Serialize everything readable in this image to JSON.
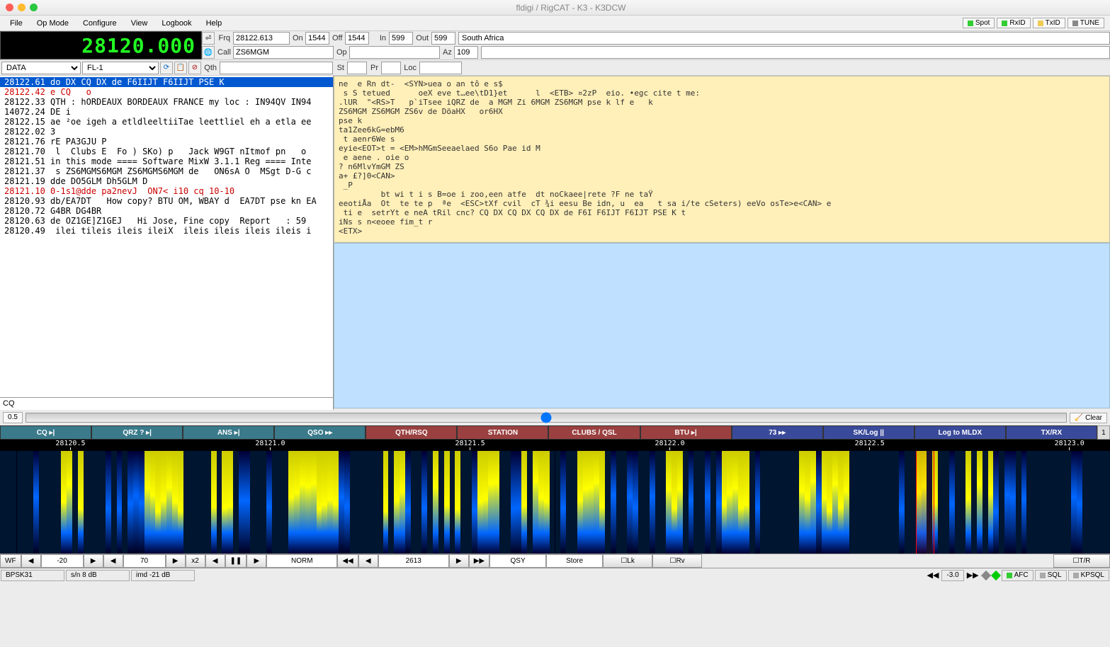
{
  "title": "fldigi / RigCAT - K3 - K3DCW",
  "menu": [
    "File",
    "Op Mode",
    "Configure",
    "View",
    "Logbook",
    "Help"
  ],
  "indicators": [
    {
      "label": "Spot",
      "led": "led-green"
    },
    {
      "label": "RxID",
      "led": "led-green"
    },
    {
      "label": "TxID",
      "led": "led-yellow"
    },
    {
      "label": "TUNE",
      "led": "led-off"
    }
  ],
  "freq_display": "28120.000",
  "log": {
    "frq_label": "Frq",
    "frq": "28122.613",
    "on_label": "On",
    "on": "1544",
    "off_label": "Off",
    "off": "1544",
    "in_label": "In",
    "in": "599",
    "out_label": "Out",
    "out": "599",
    "call_label": "Call",
    "call": "ZS6MGM",
    "op_label": "Op",
    "op": "",
    "az_label": "Az",
    "az": "109",
    "qth_label": "Qth",
    "qth": "",
    "st_label": "St",
    "st": "",
    "pr_label": "Pr",
    "pr": "",
    "loc_label": "Loc",
    "loc": "",
    "country": "South Africa"
  },
  "mode_dropdown": "DATA",
  "filter_dropdown": "FL-1",
  "spots": [
    {
      "f": "",
      "t": ""
    },
    {
      "f": "",
      "t": ""
    },
    {
      "f": "",
      "t": ""
    },
    {
      "f": "",
      "t": ""
    },
    {
      "f": "",
      "t": ""
    },
    {
      "f": "",
      "t": ""
    },
    {
      "f": "28122.61",
      "t": "do DX CQ DX de F6IIJT F6IIJT PSE K",
      "sel": true
    },
    {
      "f": "28122.42",
      "t": "e CQ   o",
      "red": true
    },
    {
      "f": "28122.33",
      "t": "QTH : hORDEAUX BORDEAUX FRANCE my loc : IN94QV IN94"
    },
    {
      "f": "14072.24",
      "t": "DE i"
    },
    {
      "f": "28122.15",
      "t": "ae ²oe igeh a etldleeltiiTae leettliel eh a etla ee"
    },
    {
      "f": "28122.02",
      "t": "3"
    },
    {
      "f": "",
      "t": ""
    },
    {
      "f": "28121.76",
      "t": "rE PA3GJU P"
    },
    {
      "f": "28121.70",
      "t": " l  Clubs E  Fo ) SKo) p   Jack W9GT nItmof pn   o"
    },
    {
      "f": "28121.51",
      "t": "in this mode ==== Software MixW 3.1.1 Reg ==== Inte"
    },
    {
      "f": "",
      "t": ""
    },
    {
      "f": "28121.37",
      "t": " s ZS6MGMS6MGM ZS6MGMS6MGM de   ON6sA O  MSgt D-G c"
    },
    {
      "f": "28121.19",
      "t": "dde DO5GLM Dh5GLM D"
    },
    {
      "f": "",
      "t": ""
    },
    {
      "f": "28121.10",
      "t": "0-1s1@dde pa2nevJ  ON7< i10 cq 10-10",
      "red": true
    },
    {
      "f": "28120.93",
      "t": "db/EA7DT   How copy? BTU OM, WBAY d  EA7DT pse kn EA"
    },
    {
      "f": "",
      "t": ""
    },
    {
      "f": "28120.72",
      "t": "G4BR DG4BR"
    },
    {
      "f": "28120.63",
      "t": "de OZ1GE]Z1GEJ   Hi Jose, Fine copy  Report   : 59"
    },
    {
      "f": "",
      "t": ""
    },
    {
      "f": "28120.49",
      "t": " ilei tileis ileis ileiX  ileis ileis ileis ileis i"
    }
  ],
  "cq_label": "CQ",
  "threshold": "0.5",
  "clear_label": "Clear",
  "rx_text": "ne  e Rn dt-  <SYN>uea o an tô e s$\n s S tetued      oeX eve t…ee\\tD1}et      l  <ETB> ¤2zP  eio. •egc cite t me:\n.lUR  \"<RS>T   p`iTsee iQRZ de  a MGM Zi 6MGM ZS6MGM pse k lf e   k\nZS6MGM ZS6MGM ZS6v de DöaHX   or6HX\npse k\nta1Zee6kG=ebM6\n t aenr6We s\neyie<EOT>t = <EM>hMGmSeeaelaed S6o Pae id M\n e aene . oie o\n? n6MlvYmGM ZS\na+ £?]0<CAN>\n _P\n         bt wi t i s B=oe i zoo,een atfe  dt noCkaee|rete ?F ne taŸ\neeotiÅa  Ot  te te p  ªe  <ESC>tXf cvil  cT ¾i eesu Be idn, u  ea   t sa i/te cSeters) eeVo osTe>e<CAN> e\n ti e  setrYt e neA tRil cnc? CQ DX CQ DX CQ DX de F6I F6IJT F6IJT PSE K t\niNs s n<eoee fim_t r\n<ETX>",
  "macros": [
    {
      "label": "CQ ▸|",
      "cls": "macro-teal"
    },
    {
      "label": "QRZ ? ▸|",
      "cls": "macro-teal"
    },
    {
      "label": "ANS ▸|",
      "cls": "macro-teal"
    },
    {
      "label": "QSO ▸▸",
      "cls": "macro-teal"
    },
    {
      "label": "QTH/RSQ",
      "cls": "macro-red"
    },
    {
      "label": "STATION",
      "cls": "macro-red"
    },
    {
      "label": "CLUBS / QSL",
      "cls": "macro-red"
    },
    {
      "label": "BTU ▸|",
      "cls": "macro-red"
    },
    {
      "label": "73 ▸▸",
      "cls": "macro-blue"
    },
    {
      "label": "SK/Log ||",
      "cls": "macro-blue"
    },
    {
      "label": "Log to MLDX",
      "cls": "macro-blue"
    },
    {
      "label": "TX/RX",
      "cls": "macro-blue"
    }
  ],
  "macro_page": "1",
  "wf_ticks": [
    "28120.5",
    "28121.0",
    "28121.5",
    "28122.0",
    "28122.5",
    "28123.0"
  ],
  "wf_ctrl": {
    "wf": "WF",
    "db": "-20",
    "range": "70",
    "zoom": "x2",
    "mode": "NORM",
    "center": "2613",
    "qsy": "QSY",
    "store": "Store",
    "lk": "Lk",
    "rv": "Rv",
    "tr": "T/R"
  },
  "status": {
    "mode": "BPSK31",
    "sn": "s/n  8 dB",
    "imd": "imd -21 dB",
    "offset": "-3.0",
    "afc": "AFC",
    "sql": "SQL",
    "kpsql": "KPSQL"
  }
}
